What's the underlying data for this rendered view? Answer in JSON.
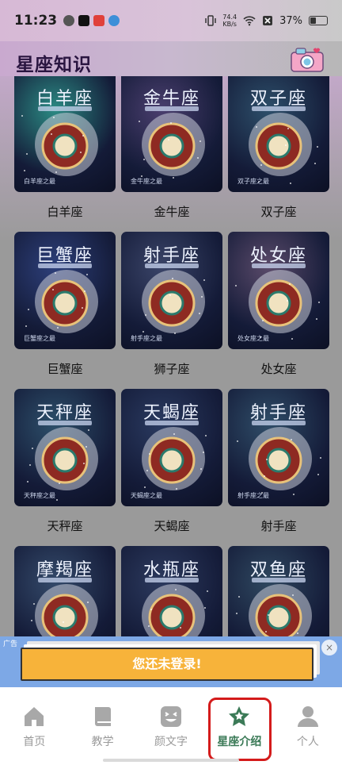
{
  "status_bar": {
    "time": "11:23",
    "net_speed_value": "74.4",
    "net_speed_unit": "KB/s",
    "battery": "37%",
    "battery_level": 0.37
  },
  "header": {
    "title": "星座知识",
    "camera_icon": "camera-icon"
  },
  "zodiac_cards": [
    {
      "label": "白羊座",
      "art_title": "白羊座",
      "foot": "白羊座之最",
      "accent": "#2b8a83"
    },
    {
      "label": "金牛座",
      "art_title": "金牛座",
      "foot": "金牛座之最",
      "accent": "#4a3e6e"
    },
    {
      "label": "双子座",
      "art_title": "双子座",
      "foot": "双子座之最",
      "accent": "#2d4f6a"
    },
    {
      "label": "巨蟹座",
      "art_title": "巨蟹座",
      "foot": "巨蟹座之最",
      "accent": "#2d3f7a"
    },
    {
      "label": "狮子座",
      "art_title": "射手座",
      "foot": "射手座之最",
      "accent": "#3a4468"
    },
    {
      "label": "处女座",
      "art_title": "处女座",
      "foot": "处女座之最",
      "accent": "#5a4a6a"
    },
    {
      "label": "天秤座",
      "art_title": "天秤座",
      "foot": "天秤座之最",
      "accent": "#2d4f6a"
    },
    {
      "label": "天蝎座",
      "art_title": "天蝎座",
      "foot": "天蝎座之最",
      "accent": "#2a3a60"
    },
    {
      "label": "射手座",
      "art_title": "射手座",
      "foot": "射手座之最",
      "accent": "#2f4d68"
    },
    {
      "label": "",
      "art_title": "摩羯座",
      "foot": "",
      "accent": "#344a6a"
    },
    {
      "label": "",
      "art_title": "水瓶座",
      "foot": "",
      "accent": "#2c3a5e"
    },
    {
      "label": "",
      "art_title": "双鱼座",
      "foot": "",
      "accent": "#2f4860"
    }
  ],
  "ad": {
    "tag": "广告",
    "close": "×",
    "login_prompt": "您还未登录!"
  },
  "tabbar": {
    "items": [
      {
        "label": "首页",
        "icon": "home-icon"
      },
      {
        "label": "教学",
        "icon": "book-icon"
      },
      {
        "label": "颜文字",
        "icon": "emoji-icon"
      },
      {
        "label": "星座介绍",
        "icon": "star-icon"
      },
      {
        "label": "个人",
        "icon": "person-icon"
      }
    ],
    "active_index": 3
  },
  "colors": {
    "active_tab": "#3b7a57",
    "login_button": "#f7b33a",
    "ad_background": "#7da8e6",
    "highlight": "#d41b1b"
  }
}
